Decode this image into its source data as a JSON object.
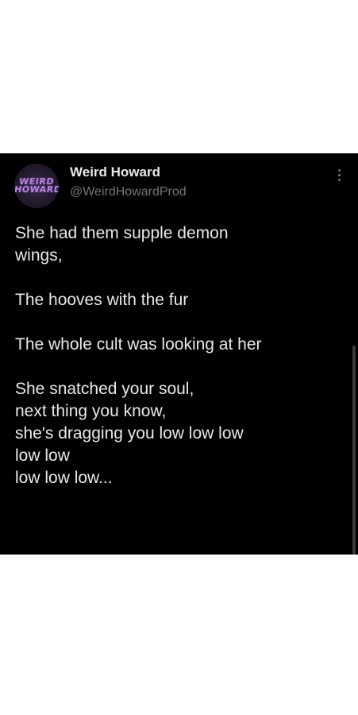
{
  "tweet": {
    "author": {
      "display_name": "Weird Howard",
      "handle": "@WeirdHowardProd",
      "avatar_text_line1": "WEIRD",
      "avatar_text_line2": "HOWARD"
    },
    "paragraphs": [
      {
        "lines": [
          "She had them supple demon",
          "wings,"
        ]
      },
      {
        "lines": [
          "The hooves with the fur"
        ]
      },
      {
        "lines": [
          "The whole cult was looking at her"
        ]
      },
      {
        "lines": [
          "She snatched your soul,",
          "next thing you know,",
          "she's dragging you low low low",
          "low low",
          "low low low..."
        ]
      }
    ]
  },
  "icons": {
    "more": "more-options-vertical-icon"
  },
  "colors": {
    "tweet_background": "#000000",
    "text_primary": "#e7e9ea",
    "text_secondary": "#71767b",
    "page_background": "#ffffff",
    "avatar_accent": "#b387d8"
  }
}
